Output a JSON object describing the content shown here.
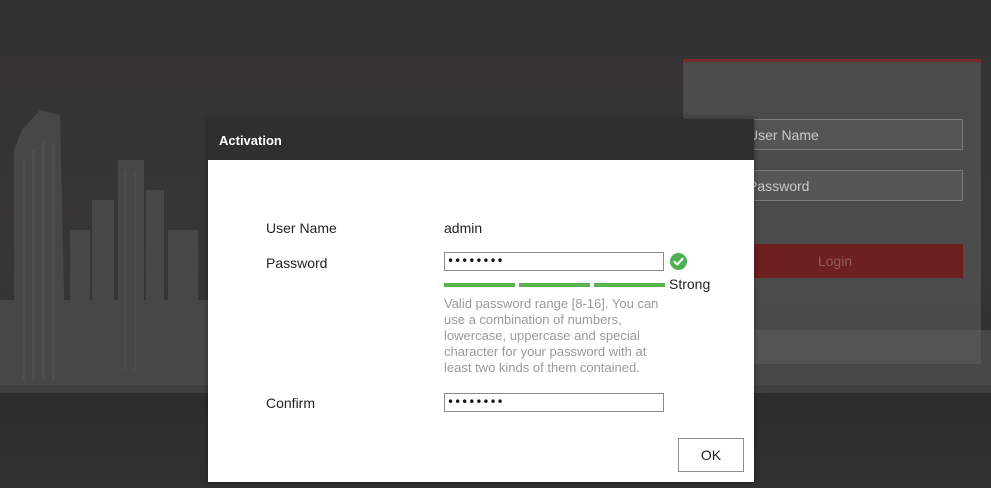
{
  "background_login": {
    "username_placeholder": "User Name",
    "password_placeholder": "Password",
    "login_label": "Login"
  },
  "dialog": {
    "title": "Activation",
    "username_label": "User Name",
    "username_value": "admin",
    "password_label": "Password",
    "password_value": "••••••••",
    "strength_label": "Strong",
    "hint": "Valid password range [8-16]. You can use a combination of numbers, lowercase, uppercase and special character for your password with at least two kinds of them contained.",
    "confirm_label": "Confirm",
    "confirm_value": "••••••••",
    "ok_label": "OK"
  },
  "colors": {
    "strength_bar": "#59b34d",
    "check_icon": "#4caf50",
    "header_bg": "#2f2f2f",
    "login_button": "#6e2020"
  },
  "icons": {
    "strength_ok": "check-circle-icon"
  }
}
